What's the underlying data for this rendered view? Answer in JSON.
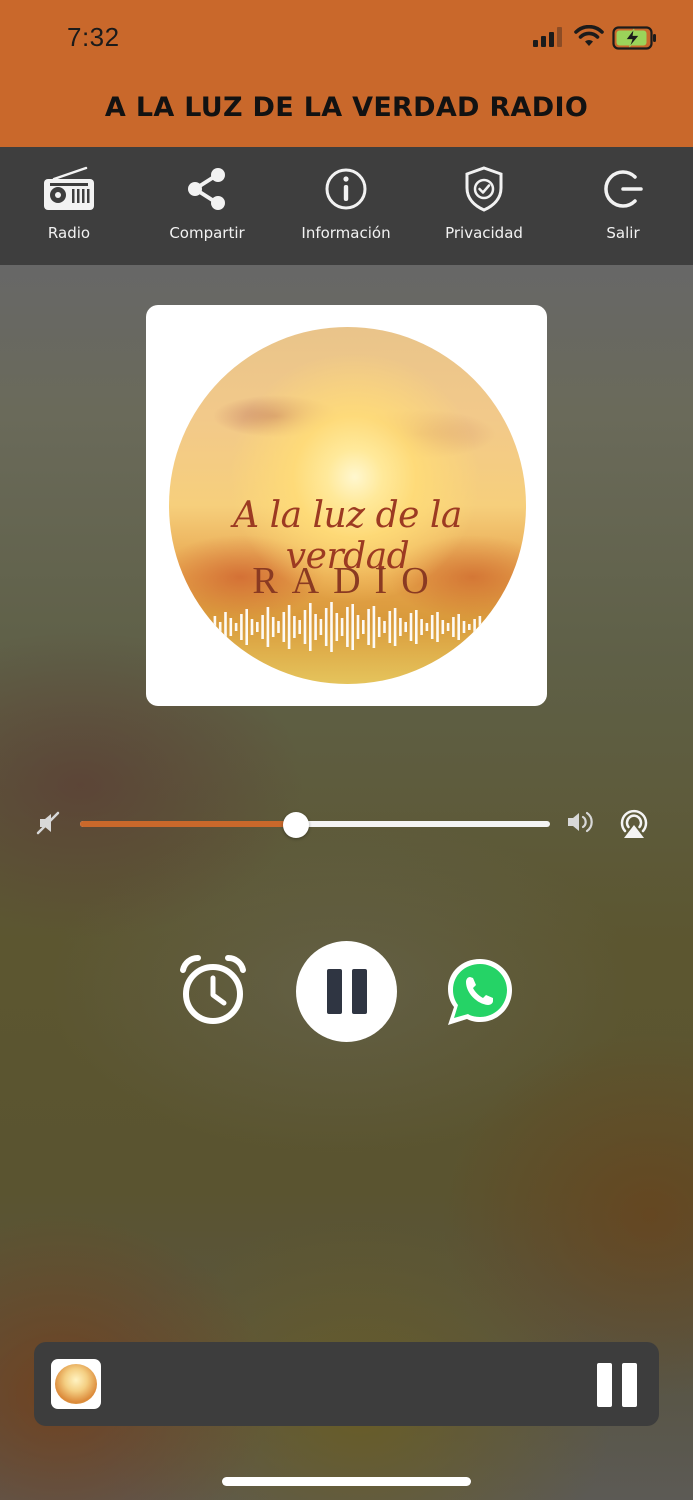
{
  "status_bar": {
    "time": "7:32"
  },
  "header": {
    "title": "A LA LUZ DE LA VERDAD RADIO"
  },
  "toolbar": {
    "items": [
      {
        "label": "Radio",
        "icon": "radio-icon"
      },
      {
        "label": "Compartir",
        "icon": "share-icon"
      },
      {
        "label": "Información",
        "icon": "info-icon"
      },
      {
        "label": "Privacidad",
        "icon": "shield-check-icon"
      },
      {
        "label": "Salir",
        "icon": "power-icon"
      }
    ]
  },
  "artwork": {
    "script_text": "A la luz de la verdad",
    "radio_text": "RADIO"
  },
  "volume": {
    "level": 0.46
  },
  "colors": {
    "accent": "#c9682b",
    "toolbar_bg": "#3e3e3e",
    "whatsapp": "#25d366",
    "play_icon": "#2f3542"
  },
  "controls": {
    "alarm_icon": "alarm-clock-icon",
    "play_state": "playing",
    "whatsapp_icon": "whatsapp-icon"
  },
  "mini_player": {
    "state": "playing"
  }
}
